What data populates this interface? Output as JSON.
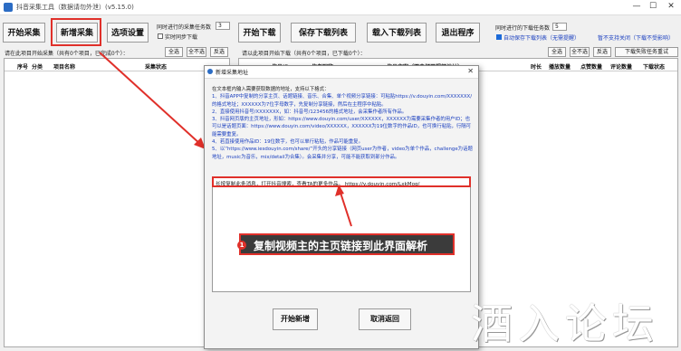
{
  "window": {
    "title": "抖音采集工具（数据请勿外泄）(v5.15.0)",
    "minimize": "—",
    "maximize": "☐",
    "close": "✕"
  },
  "toolbar": {
    "start_collect": "开始采集",
    "add_collect": "新增采集",
    "options": "选项设置",
    "start_download": "开始下载",
    "save_download_list": "保存下载列表",
    "load_download_list": "载入下载列表",
    "exit": "退出程序",
    "threads_label": "同时进行的采集任务数",
    "threads_value": "3",
    "realtime_label": "实时同步下载",
    "dl_threads_label": "同时进行的下载任务数",
    "dl_threads_value": "5",
    "auto_save_label": "自动保存下载列表（无需提醒）",
    "auto_save_note": "暂不支持关闭（下载不受影响）"
  },
  "left_panel": {
    "info": "请在此项目开始采集（共有0个项目，已完成0个）：",
    "btn_all": "全选",
    "btn_invert": "全不选",
    "btn_invert2": "反选",
    "headers": [
      "序号",
      "分类",
      "项目名称",
      "采集状态"
    ]
  },
  "right_panel": {
    "info": "请以此项目开始下载（共有0个项目，已下载0个）：",
    "btn_all": "全选",
    "btn_invert": "全不选",
    "btn_invert2": "反选",
    "btn_retry": "下载失败任务重试",
    "headers": [
      "作品ID",
      "作者昵称",
      "作品文案（双击打开视频地址）",
      "时长",
      "播放数量",
      "点赞数量",
      "评论数量",
      "下载状态"
    ]
  },
  "dialog": {
    "title": "新增采集地址",
    "instructions": [
      "在文本框内输入需要获取数据的地址，支持以下格式：",
      "1、抖音APP中复制的分享主页、话题链接、音乐、合集、单个视频分享链接：可粘贴https://v.douyin.com/XXXXXXX/的格式地址；XXXXXX为7位字母数字，先复制分享链接，然后在主程序中粘贴。",
      "2、直接使用抖音号/XXXXXXX，如：抖音号/123456的格式地址，会采集作者所有作品。",
      "3、抖音网页版的主页地址，形如：https://www.douyin.com/user/XXXXXX，XXXXXX为需要采集作者的用户ID；也可以是话题页面：https://www.douyin.com/video/XXXXXX，XXXXXX为19位数字的作品ID，也可换行粘贴，行隔可能需要重复。",
      "4、若直接使用作品ID：19位数字，也可以单行粘贴，作品可能重复。",
      "5、以“https://www.iesdouyin.com/share/”开头的分享链接（网页user为作者，video为单个作品，challenge为话题地址，music为音乐，mix/detail为合集）。会采集并分享，可能不能获取到部分作品。"
    ],
    "input_text": "长按复制此条消息，打开抖音搜索，查看TA的更多作品。 https://v.douyin.com/LxkMoq/",
    "callout_num": "1",
    "callout_text": "复制视频主的主页链接到此界面解析",
    "ok_button": "开始新增",
    "cancel_button": "取消返回"
  },
  "watermark": "酒入论坛"
}
